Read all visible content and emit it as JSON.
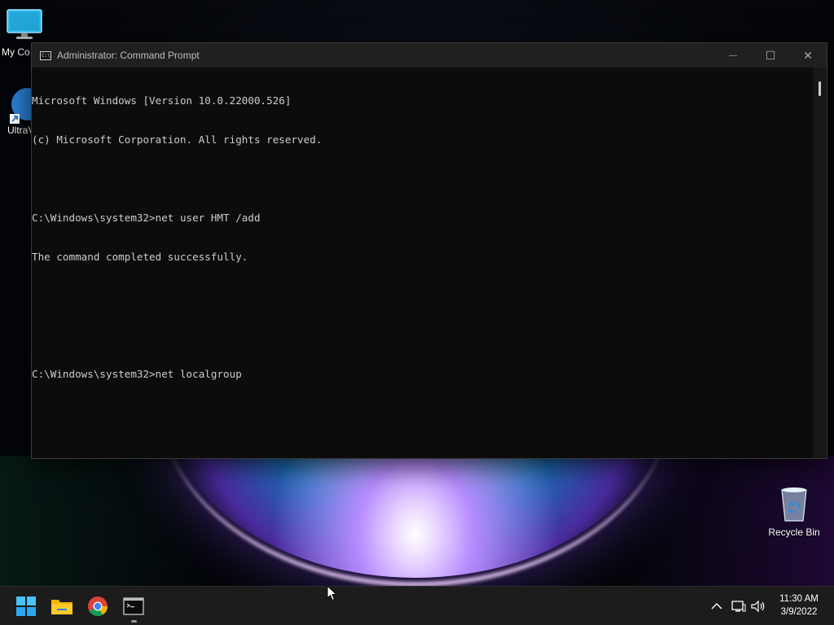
{
  "desktop": {
    "icons": [
      {
        "label": "My Co",
        "icon": "monitor-icon"
      },
      {
        "label": "UltraV",
        "icon": "ultravnc-shortcut-icon"
      },
      {
        "label": "Recycle Bin",
        "icon": "recycle-bin-icon"
      }
    ]
  },
  "window": {
    "title": "Administrator: Command Prompt",
    "minimize_glyph": "—",
    "maximize_glyph": "☐",
    "close_glyph": "✕",
    "lines": [
      "Microsoft Windows [Version 10.0.22000.526]",
      "(c) Microsoft Corporation. All rights reserved.",
      "",
      "C:\\Windows\\system32>net user HMT /add",
      "The command completed successfully.",
      "",
      "",
      "C:\\Windows\\system32>net localgroup"
    ]
  },
  "taskbar": {
    "apps": [
      "start-icon",
      "file-explorer-icon",
      "chrome-icon",
      "command-prompt-icon"
    ],
    "tray": {
      "chevron": "^",
      "time": "11:30 AM",
      "date": "3/9/2022"
    }
  },
  "colors": {
    "console_bg": "#0c0c0c",
    "console_text": "#cccccc",
    "titlebar": "#202020",
    "taskbar": "#1c1c1c"
  }
}
